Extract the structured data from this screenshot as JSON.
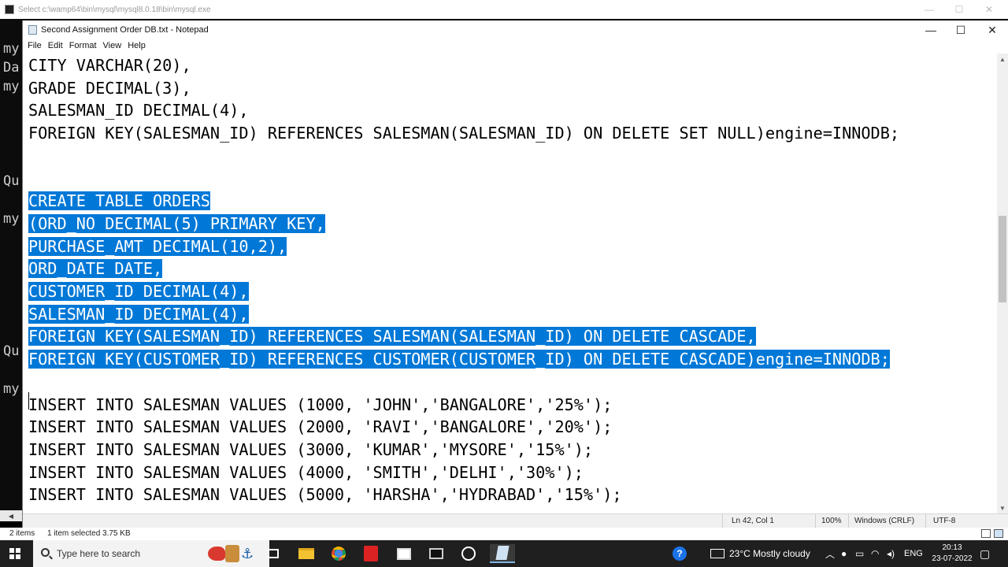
{
  "console": {
    "title": "Select c:\\wamp64\\bin\\mysql\\mysql8.0.18\\bin\\mysql.exe",
    "fragments": [
      {
        "text": "my"
      },
      {
        "text": "Da"
      },
      {
        "text": "my"
      },
      {
        "text": "Qu"
      },
      {
        "text": "my"
      },
      {
        "text": "Qu"
      },
      {
        "text": "my"
      }
    ]
  },
  "notepad": {
    "title": "Second Assignment Order DB.txt - Notepad",
    "menu": [
      "File",
      "Edit",
      "Format",
      "View",
      "Help"
    ],
    "lines": [
      {
        "text": "CITY VARCHAR(20),",
        "selected": false
      },
      {
        "text": "GRADE DECIMAL(3),",
        "selected": false
      },
      {
        "text": "SALESMAN_ID DECIMAL(4),",
        "selected": false
      },
      {
        "text": "FOREIGN KEY(SALESMAN_ID) REFERENCES SALESMAN(SALESMAN_ID) ON DELETE SET NULL)engine=INNODB;",
        "selected": false
      },
      {
        "text": "",
        "selected": false
      },
      {
        "text": "",
        "selected": false
      },
      {
        "text": "CREATE TABLE ORDERS",
        "selected": true
      },
      {
        "text": "(ORD_NO DECIMAL(5) PRIMARY KEY,",
        "selected": true
      },
      {
        "text": "PURCHASE_AMT DECIMAL(10,2),",
        "selected": true
      },
      {
        "text": "ORD_DATE DATE,",
        "selected": true
      },
      {
        "text": "CUSTOMER_ID DECIMAL(4),",
        "selected": true
      },
      {
        "text": "SALESMAN_ID DECIMAL(4),",
        "selected": true
      },
      {
        "text": "FOREIGN KEY(SALESMAN_ID) REFERENCES SALESMAN(SALESMAN_ID) ON DELETE CASCADE,",
        "selected": true
      },
      {
        "text": "FOREIGN KEY(CUSTOMER_ID) REFERENCES CUSTOMER(CUSTOMER_ID) ON DELETE CASCADE)engine=INNODB;",
        "selected": true
      },
      {
        "text": "",
        "selected": false
      },
      {
        "text": "INSERT INTO SALESMAN VALUES (1000, 'JOHN','BANGALORE','25%');",
        "selected": false
      },
      {
        "text": "INSERT INTO SALESMAN VALUES (2000, 'RAVI','BANGALORE','20%');",
        "selected": false
      },
      {
        "text": "INSERT INTO SALESMAN VALUES (3000, 'KUMAR','MYSORE','15%');",
        "selected": false
      },
      {
        "text": "INSERT INTO SALESMAN VALUES (4000, 'SMITH','DELHI','30%');",
        "selected": false
      },
      {
        "text": "INSERT INTO SALESMAN VALUES (5000, 'HARSHA','HYDRABAD','15%');",
        "selected": false
      }
    ],
    "status": {
      "position": "Ln 42, Col 1",
      "zoom": "100%",
      "line_ending": "Windows (CRLF)",
      "encoding": "UTF-8"
    }
  },
  "explorer_status": {
    "items": "2 items",
    "selected": "1 item selected  3.75 KB"
  },
  "taskbar": {
    "search_placeholder": "Type here to search",
    "weather": "23°C  Mostly cloudy",
    "language": "ENG",
    "time": "20:13",
    "date": "23-07-2022"
  },
  "colors": {
    "selection": "#0078d7",
    "taskbar": "#1f1f1f"
  }
}
